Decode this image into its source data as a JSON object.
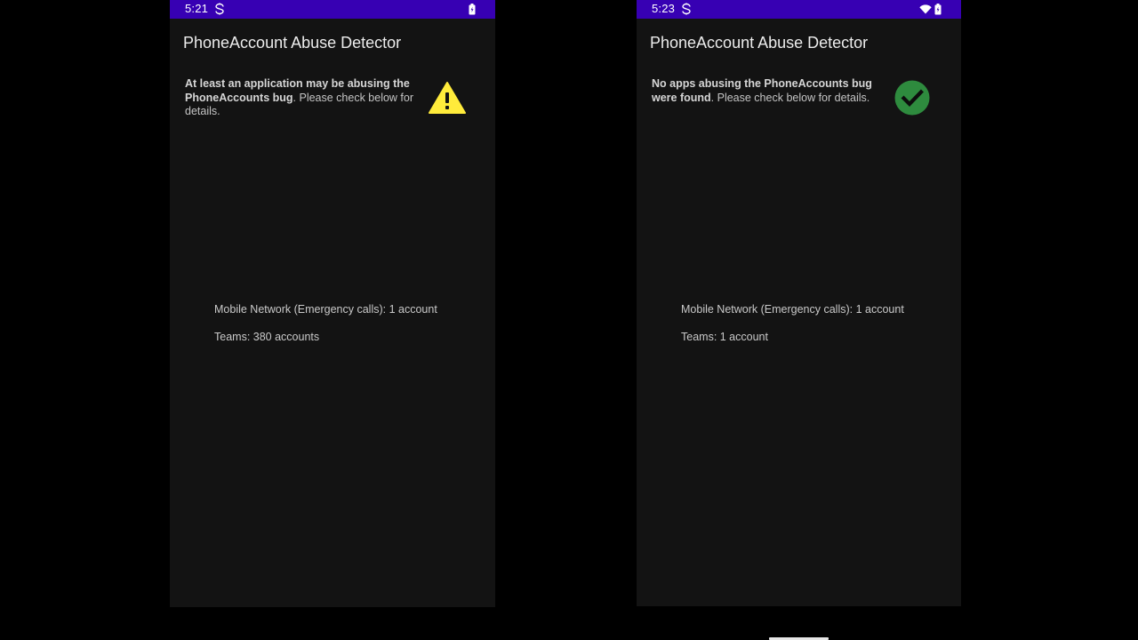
{
  "screens": [
    {
      "status_time": "5:21",
      "title": "PhoneAccount Abuse Detector",
      "summary": {
        "bold": "At least an application may be abusing the PhoneAccounts bug",
        "rest": ". Please check below for details."
      },
      "status_icon": "warning-icon",
      "accounts": [
        "Mobile Network (Emergency calls): 1 account",
        "Teams: 380 accounts"
      ]
    },
    {
      "status_time": "5:23",
      "title": "PhoneAccount Abuse Detector",
      "summary": {
        "bold": "No apps abusing the PhoneAccounts bug were found",
        "rest": ". Please check below for details."
      },
      "status_icon": "check-circle-icon",
      "accounts": [
        "Mobile Network (Emergency calls): 1 account",
        "Teams: 1 account"
      ]
    }
  ],
  "colors": {
    "status_bar": "#3700b3",
    "background": "#131313",
    "warning": "#ffeb3b",
    "success": "#2e8b3e"
  }
}
